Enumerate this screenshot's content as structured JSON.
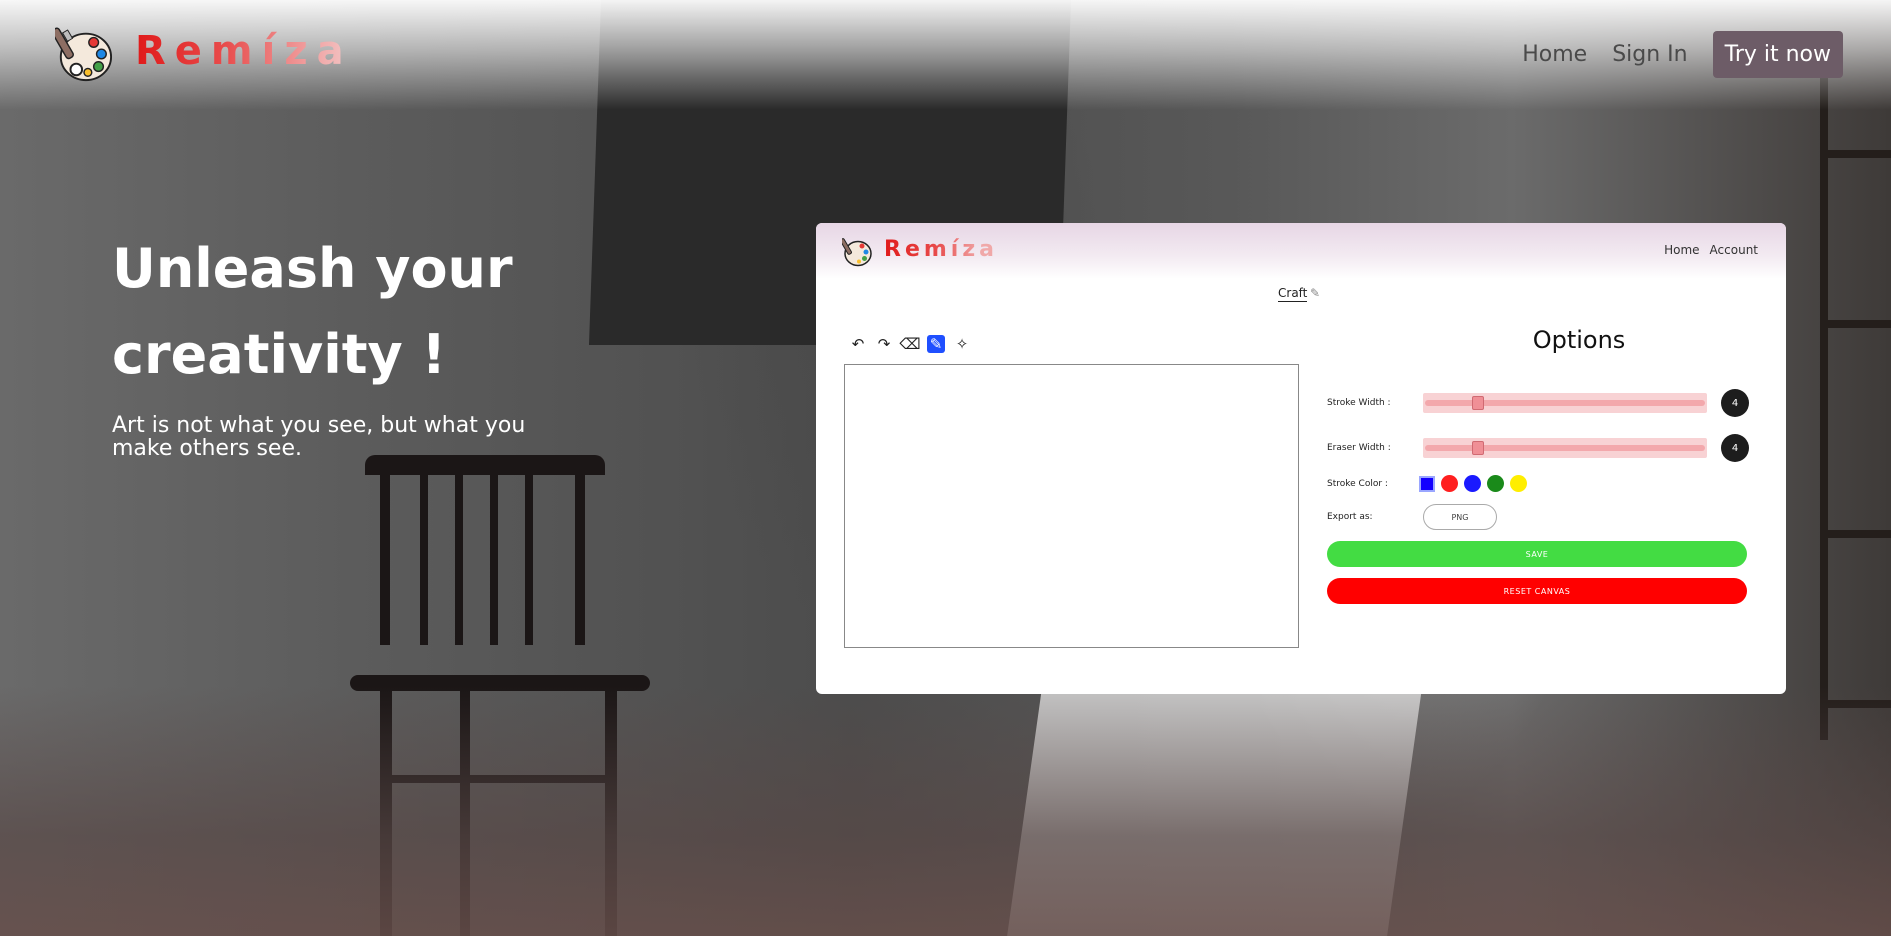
{
  "brand": {
    "name": "Remíza",
    "colors": {
      "primary": "#e01a1a",
      "cta_bg": "#6d5c67"
    }
  },
  "nav": {
    "home": "Home",
    "sign_in": "Sign In",
    "cta": "Try it now"
  },
  "hero": {
    "title_line1": "Unleash your",
    "title_line2": "creativity !",
    "subtitle": "Art is not what you see, but what you make others see."
  },
  "preview": {
    "brand": "Remíza",
    "nav": {
      "home": "Home",
      "account": "Account"
    },
    "doc_name": "Craft",
    "tools": [
      "undo-icon",
      "redo-icon",
      "eraser-icon",
      "brush-icon",
      "clear-icon"
    ],
    "options_title": "Options",
    "stroke_width": {
      "label": "Stroke Width :",
      "value": "4",
      "level": 0.18
    },
    "eraser_width": {
      "label": "Eraser Width :",
      "value": "4",
      "level": 0.18
    },
    "stroke_color": {
      "label": "Stroke Color :",
      "selected": "#1300ff",
      "swatches": [
        "#ff1f1f",
        "#1a1aff",
        "#1a8a1a",
        "#ffee00"
      ]
    },
    "export": {
      "label": "Export as:",
      "value": "PNG"
    },
    "save_label": "SAVE",
    "save_color": "#43dc43",
    "reset_label": "RESET CANVAS",
    "reset_color": "#ff0000"
  }
}
